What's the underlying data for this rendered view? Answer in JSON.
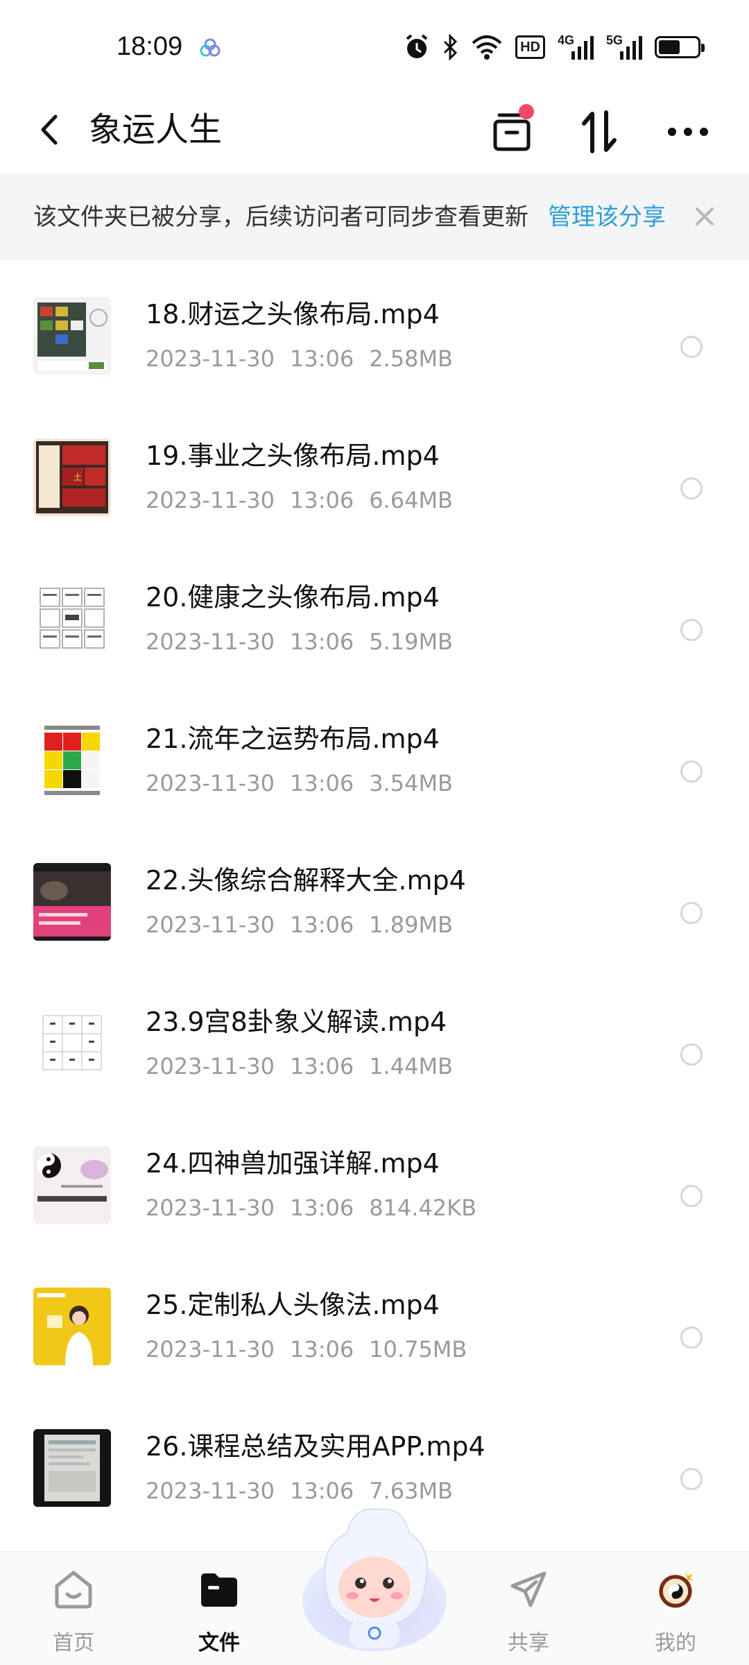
{
  "status_bar": {
    "time": "18:09",
    "hd": "HD",
    "net1": "4G",
    "net2": "5G",
    "battery_level": 0.55,
    "icons": [
      "app-cloud-icon",
      "alarm-icon",
      "bluetooth-icon",
      "wifi-icon",
      "signal-icon",
      "battery-icon"
    ]
  },
  "header": {
    "title": "象运人生",
    "icons": [
      "back-icon",
      "inbox-icon",
      "sort-icon",
      "more-icon"
    ]
  },
  "banner": {
    "text": "该文件夹已被分享，后续访问者可同步查看更新",
    "link": "管理该分享",
    "close_icon": "close-icon"
  },
  "files": [
    {
      "name": "18.财运之头像布局.mp4",
      "date": "2023-11-30",
      "time": "13:06",
      "size": "2.58MB"
    },
    {
      "name": "19.事业之头像布局.mp4",
      "date": "2023-11-30",
      "time": "13:06",
      "size": "6.64MB"
    },
    {
      "name": "20.健康之头像布局.mp4",
      "date": "2023-11-30",
      "time": "13:06",
      "size": "5.19MB"
    },
    {
      "name": "21.流年之运势布局.mp4",
      "date": "2023-11-30",
      "time": "13:06",
      "size": "3.54MB"
    },
    {
      "name": "22.头像综合解释大全.mp4",
      "date": "2023-11-30",
      "time": "13:06",
      "size": "1.89MB"
    },
    {
      "name": "23.9宫8卦象义解读.mp4",
      "date": "2023-11-30",
      "time": "13:06",
      "size": "1.44MB"
    },
    {
      "name": "24.四神兽加强详解.mp4",
      "date": "2023-11-30",
      "time": "13:06",
      "size": "814.42KB"
    },
    {
      "name": "25.定制私人头像法.mp4",
      "date": "2023-11-30",
      "time": "13:06",
      "size": "10.75MB"
    },
    {
      "name": "26.课程总结及实用APP.mp4",
      "date": "2023-11-30",
      "time": "13:06",
      "size": "7.63MB"
    }
  ],
  "nav": [
    {
      "label": "首页",
      "icon": "home-icon",
      "active": false
    },
    {
      "label": "文件",
      "icon": "folder-icon",
      "active": true
    },
    {
      "label": "共享",
      "icon": "share-icon",
      "active": false
    },
    {
      "label": "我的",
      "icon": "avatar",
      "active": false
    }
  ],
  "colors": {
    "accent_link": "#2f9fd6",
    "badge_dot": "#f0476a",
    "meta_text": "#9a9a9a",
    "banner_bg": "#f4f5f7"
  }
}
